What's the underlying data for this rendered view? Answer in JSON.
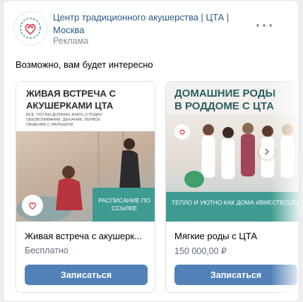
{
  "post": {
    "author": "Центр традиционного акушерства | ЦТА | Москва",
    "label": "Реклама",
    "intro": "Возможно, вам будет интересно"
  },
  "carousel": [
    {
      "banner_title": "ЖИВАЯ ВСТРЕЧА С АКУШЕРКАМИ ЦТА",
      "banner_text": "ВСЁ, ЧТО ВЫ ДОЛЖНЫ ЗНАТЬ О РОДАХ: ОБЕЗБОЛИВАНИЕ, ДЫХАНИЕ, ПЕРВОЕ ОБЩЕНИЕ С МАЛЫШОМ",
      "banner_cta": "РАСПИСАНИЕ ПО ССЫЛКЕ",
      "title": "Живая встреча с акушерк...",
      "price": "Бесплатно",
      "button": "Записаться"
    },
    {
      "banner_title": "ДОМАШНИЕ РОДЫ В РОДДОМЕ С ЦТА",
      "banner_cta": "ТЕПЛО И УЮТНО КАК ДОМА #ВМЕСТЕСЦТА",
      "title": "Мягкие роды с ЦТА",
      "price": "150 000,00 ₽",
      "button": "Записаться"
    }
  ],
  "icons": {
    "logo": "heart-logo-icon",
    "more": "more-horizontal-icon",
    "next": "chevron-right-icon"
  },
  "colors": {
    "link": "#2a5885",
    "button": "#5181b8",
    "teal": "#3f9a92",
    "logo_red": "#e04a5a"
  }
}
